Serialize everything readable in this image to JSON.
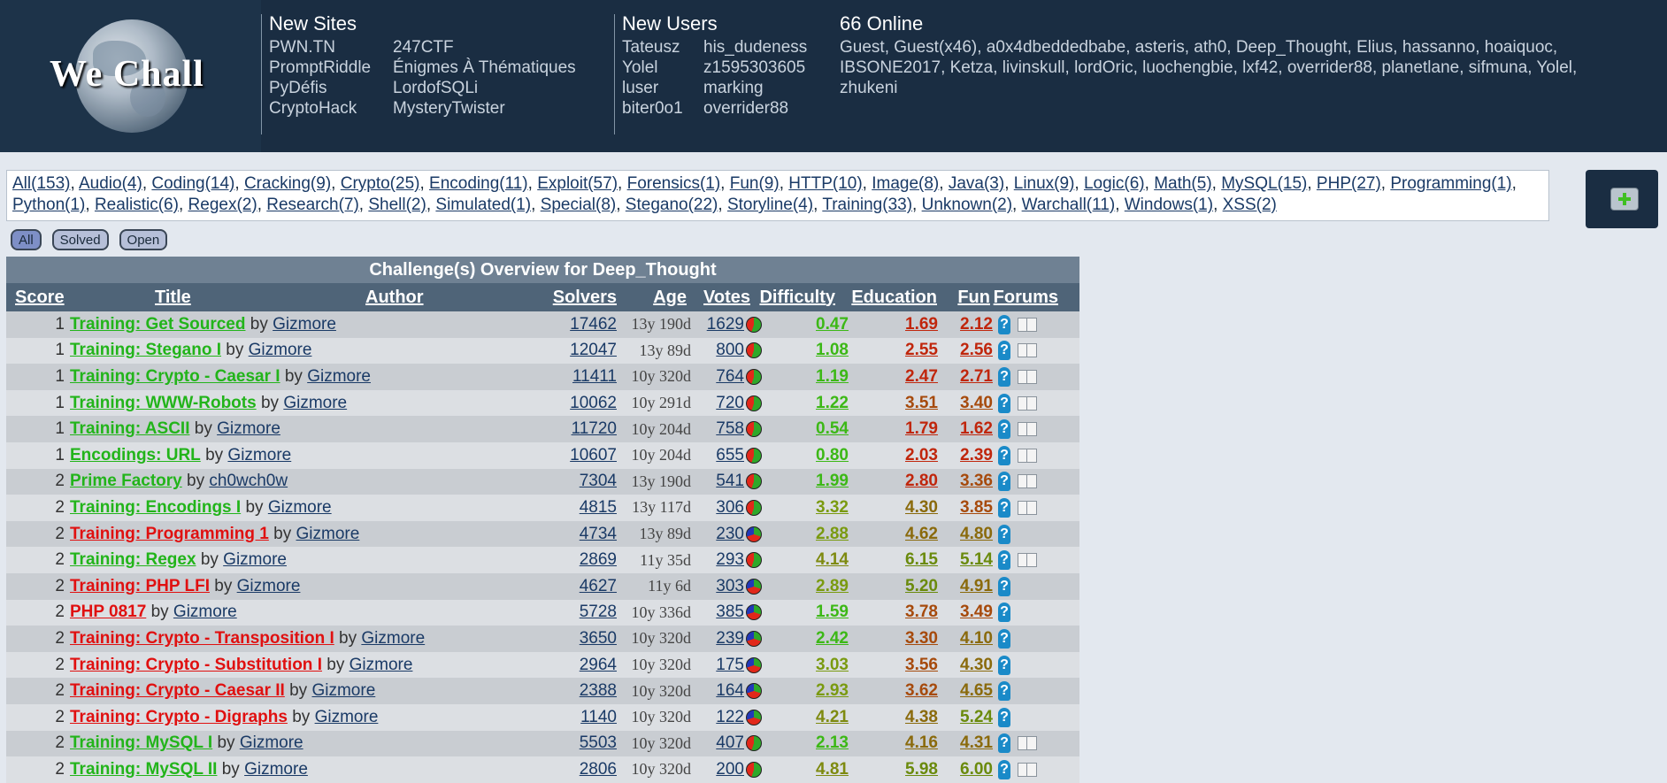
{
  "header": {
    "logo_text": "We Chall",
    "new_sites": {
      "title": "New Sites",
      "col1": [
        "PWN.TN",
        "PromptRiddle",
        "PyDéfis",
        "CryptoHack"
      ],
      "col2": [
        "247CTF",
        "Énigmes À Thématiques",
        "LordofSQLi",
        "MysteryTwister"
      ]
    },
    "new_users": {
      "title": "New Users",
      "col1": [
        "Tateusz",
        "Yolel",
        "luser",
        "biter0o1"
      ],
      "col2": [
        "his_dudeness",
        "z1595303605",
        "marking",
        "overrider88"
      ]
    },
    "online": {
      "title": "66 Online",
      "text": "Guest, Guest(x46), a0x4dbeddedbabe, asteris, ath0, Deep_Thought, Elius, hassanno, hoaiquoc, IBSONE2017, Ketza, livinskull, lordOric, luochengbie, lxf42, overrider88, planetlane, sifmuna, Yolel, zhukeni"
    }
  },
  "filters": {
    "tags": [
      "All(153)",
      "Audio(4)",
      "Coding(14)",
      "Cracking(9)",
      "Crypto(25)",
      "Encoding(11)",
      "Exploit(57)",
      "Forensics(1)",
      "Fun(9)",
      "HTTP(10)",
      "Image(8)",
      "Java(3)",
      "Linux(9)",
      "Logic(6)",
      "Math(5)",
      "MySQL(15)",
      "PHP(27)",
      "Programming(1)",
      "Python(1)",
      "Realistic(6)",
      "Regex(2)",
      "Research(7)",
      "Shell(2)",
      "Simulated(1)",
      "Special(8)",
      "Stegano(22)",
      "Storyline(4)",
      "Training(33)",
      "Unknown(2)",
      "Warchall(11)",
      "Windows(1)",
      "XSS(2)"
    ],
    "buttons": [
      "All",
      "Solved",
      "Open"
    ]
  },
  "table": {
    "caption": "Challenge(s) Overview for Deep_Thought",
    "headers": [
      "Score",
      "Title",
      "Author",
      "Solvers",
      "Age",
      "Votes",
      "Difficulty",
      "Education",
      "Fun",
      "Forums"
    ],
    "by_word": "by",
    "rows": [
      {
        "score": "1",
        "title": "Training: Get Sourced",
        "author": "Gizmore",
        "solvers": "17462",
        "age": "13y 190d",
        "votes": "1629",
        "difficulty": "0.47",
        "education": "1.69",
        "fun": "2.12",
        "solved": true,
        "forum": true
      },
      {
        "score": "1",
        "title": "Training: Stegano I",
        "author": "Gizmore",
        "solvers": "12047",
        "age": "13y 89d",
        "votes": "800",
        "difficulty": "1.08",
        "education": "2.55",
        "fun": "2.56",
        "solved": true,
        "forum": true
      },
      {
        "score": "1",
        "title": "Training: Crypto - Caesar I",
        "author": "Gizmore",
        "solvers": "11411",
        "age": "10y 320d",
        "votes": "764",
        "difficulty": "1.19",
        "education": "2.47",
        "fun": "2.71",
        "solved": true,
        "forum": true
      },
      {
        "score": "1",
        "title": "Training: WWW-Robots",
        "author": "Gizmore",
        "solvers": "10062",
        "age": "10y 291d",
        "votes": "720",
        "difficulty": "1.22",
        "education": "3.51",
        "fun": "3.40",
        "solved": true,
        "forum": true
      },
      {
        "score": "1",
        "title": "Training: ASCII",
        "author": "Gizmore",
        "solvers": "11720",
        "age": "10y 204d",
        "votes": "758",
        "difficulty": "0.54",
        "education": "1.79",
        "fun": "1.62",
        "solved": true,
        "forum": true
      },
      {
        "score": "1",
        "title": "Encodings: URL",
        "author": "Gizmore",
        "solvers": "10607",
        "age": "10y 204d",
        "votes": "655",
        "difficulty": "0.80",
        "education": "2.03",
        "fun": "2.39",
        "solved": true,
        "forum": true
      },
      {
        "score": "2",
        "title": "Prime Factory",
        "author": "ch0wch0w",
        "solvers": "7304",
        "age": "13y 190d",
        "votes": "541",
        "difficulty": "1.99",
        "education": "2.80",
        "fun": "3.36",
        "solved": true,
        "forum": true
      },
      {
        "score": "2",
        "title": "Training: Encodings I",
        "author": "Gizmore",
        "solvers": "4815",
        "age": "13y 117d",
        "votes": "306",
        "difficulty": "3.32",
        "education": "4.30",
        "fun": "3.85",
        "solved": true,
        "forum": true
      },
      {
        "score": "2",
        "title": "Training: Programming 1",
        "author": "Gizmore",
        "solvers": "4734",
        "age": "13y 89d",
        "votes": "230",
        "difficulty": "2.88",
        "education": "4.62",
        "fun": "4.80",
        "solved": false,
        "forum": false
      },
      {
        "score": "2",
        "title": "Training: Regex",
        "author": "Gizmore",
        "solvers": "2869",
        "age": "11y 35d",
        "votes": "293",
        "difficulty": "4.14",
        "education": "6.15",
        "fun": "5.14",
        "solved": true,
        "forum": true
      },
      {
        "score": "2",
        "title": "Training: PHP LFI",
        "author": "Gizmore",
        "solvers": "4627",
        "age": "11y 6d",
        "votes": "303",
        "difficulty": "2.89",
        "education": "5.20",
        "fun": "4.91",
        "solved": false,
        "forum": false
      },
      {
        "score": "2",
        "title": "PHP 0817",
        "author": "Gizmore",
        "solvers": "5728",
        "age": "10y 336d",
        "votes": "385",
        "difficulty": "1.59",
        "education": "3.78",
        "fun": "3.49",
        "solved": false,
        "forum": false
      },
      {
        "score": "2",
        "title": "Training: Crypto - Transposition I",
        "author": "Gizmore",
        "solvers": "3650",
        "age": "10y 320d",
        "votes": "239",
        "difficulty": "2.42",
        "education": "3.30",
        "fun": "4.10",
        "solved": false,
        "forum": false
      },
      {
        "score": "2",
        "title": "Training: Crypto - Substitution I",
        "author": "Gizmore",
        "solvers": "2964",
        "age": "10y 320d",
        "votes": "175",
        "difficulty": "3.03",
        "education": "3.56",
        "fun": "4.30",
        "solved": false,
        "forum": false
      },
      {
        "score": "2",
        "title": "Training: Crypto - Caesar II",
        "author": "Gizmore",
        "solvers": "2388",
        "age": "10y 320d",
        "votes": "164",
        "difficulty": "2.93",
        "education": "3.62",
        "fun": "4.65",
        "solved": false,
        "forum": false
      },
      {
        "score": "2",
        "title": "Training: Crypto - Digraphs",
        "author": "Gizmore",
        "solvers": "1140",
        "age": "10y 320d",
        "votes": "122",
        "difficulty": "4.21",
        "education": "4.38",
        "fun": "5.24",
        "solved": false,
        "forum": false
      },
      {
        "score": "2",
        "title": "Training: MySQL I",
        "author": "Gizmore",
        "solvers": "5503",
        "age": "10y 320d",
        "votes": "407",
        "difficulty": "2.13",
        "education": "4.16",
        "fun": "4.31",
        "solved": true,
        "forum": true
      },
      {
        "score": "2",
        "title": "Training: MySQL II",
        "author": "Gizmore",
        "solvers": "2806",
        "age": "10y 320d",
        "votes": "200",
        "difficulty": "4.81",
        "education": "5.98",
        "fun": "6.00",
        "solved": true,
        "forum": true
      }
    ]
  },
  "colors": {
    "solved_title": "#22b41a",
    "unsolved_title": "#e01010"
  }
}
